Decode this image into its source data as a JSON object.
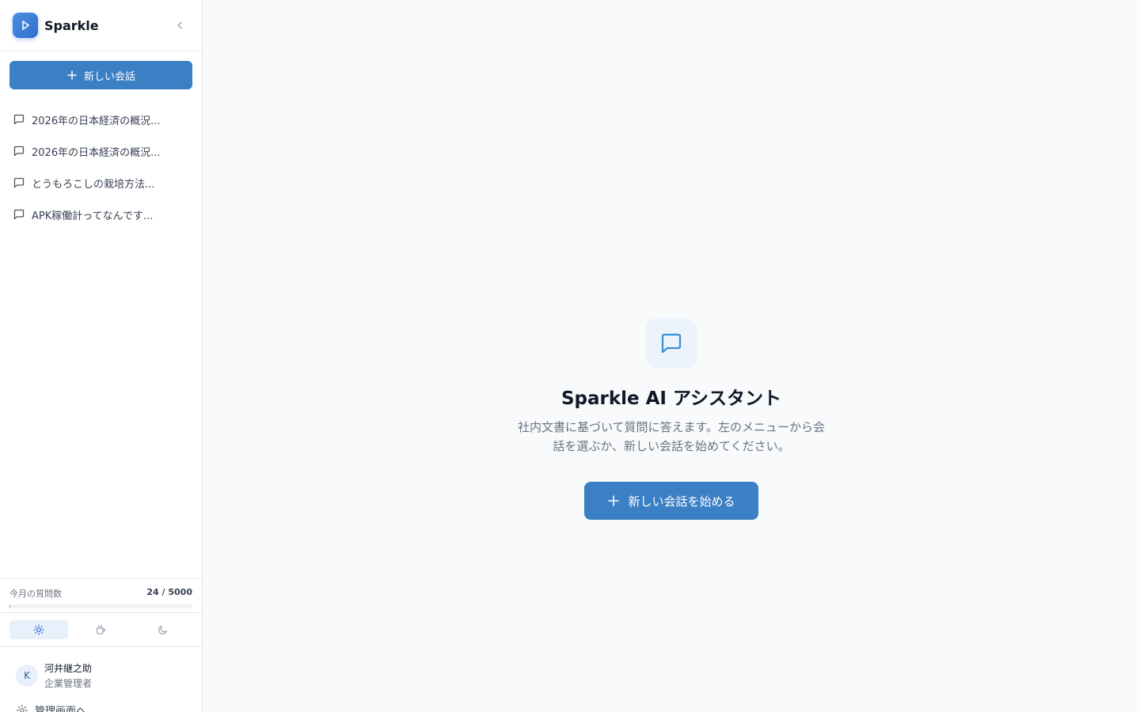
{
  "app": {
    "name": "Sparkle"
  },
  "sidebar": {
    "new_chat_label": "新しい会話",
    "conversations": [
      {
        "label": "2026年の日本経済の概況..."
      },
      {
        "label": "2026年の日本経済の概況..."
      },
      {
        "label": "とうもろこしの栽培方法..."
      },
      {
        "label": "APK稼働計ってなんです..."
      }
    ],
    "usage": {
      "label": "今月の質問数",
      "value_text": "24 / 5000",
      "used": 24,
      "limit": 5000
    },
    "theme": {
      "options": [
        "light",
        "coffee",
        "dark"
      ],
      "selected": "light"
    },
    "user": {
      "initial": "K",
      "name": "河井継之助",
      "role": "企業管理者"
    },
    "admin_link": "管理画面へ"
  },
  "main": {
    "title": "Sparkle AI アシスタント",
    "description": "社内文書に基づいて質問に答えます。左のメニューから会話を選ぶか、新しい会話を始めてください。",
    "start_button": "新しい会話を始める"
  },
  "colors": {
    "accent": "#3b7fc4",
    "logo": "#4a8fe0"
  },
  "icons": {
    "logo": "play-icon",
    "collapse": "chevron-left-icon",
    "conversation": "message-square-icon",
    "plus": "plus-icon",
    "light": "sun-icon",
    "coffee": "coffee-icon",
    "dark": "moon-icon",
    "admin": "gear-icon"
  }
}
